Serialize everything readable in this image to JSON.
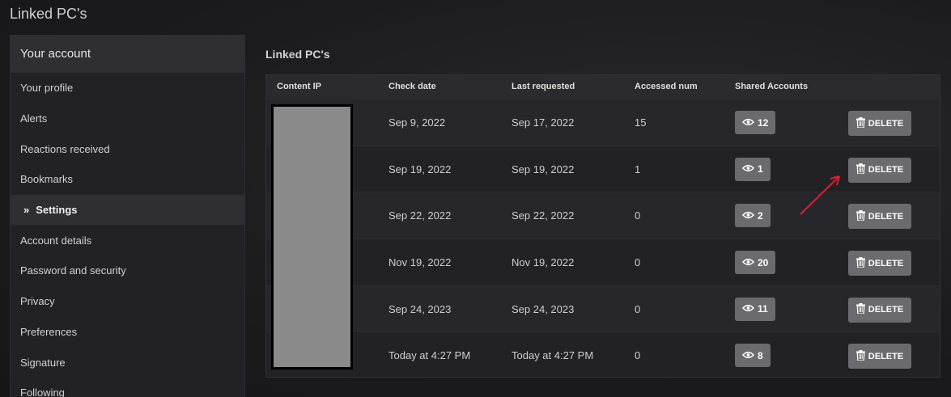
{
  "page": {
    "title": "Linked PC's"
  },
  "sidebar": {
    "header": "Your account",
    "items": [
      {
        "label": "Your profile",
        "active": false
      },
      {
        "label": "Alerts",
        "active": false
      },
      {
        "label": "Reactions received",
        "active": false
      },
      {
        "label": "Bookmarks",
        "active": false
      },
      {
        "label": "Settings",
        "active": true
      },
      {
        "label": "Account details",
        "active": false
      },
      {
        "label": "Password and security",
        "active": false
      },
      {
        "label": "Privacy",
        "active": false
      },
      {
        "label": "Preferences",
        "active": false
      },
      {
        "label": "Signature",
        "active": false
      },
      {
        "label": "Following",
        "active": false
      }
    ]
  },
  "main": {
    "title": "Linked PC's",
    "columns": {
      "content_ip": "Content IP",
      "check_date": "Check date",
      "last_requested": "Last requested",
      "accessed_num": "Accessed num",
      "shared_accounts": "Shared Accounts"
    },
    "delete_label": "DELETE",
    "rows": [
      {
        "check_date": "Sep 9, 2022",
        "last_requested": "Sep 17, 2022",
        "accessed_num": "15",
        "shared": "12"
      },
      {
        "check_date": "Sep 19, 2022",
        "last_requested": "Sep 19, 2022",
        "accessed_num": "1",
        "shared": "1"
      },
      {
        "check_date": "Sep 22, 2022",
        "last_requested": "Sep 22, 2022",
        "accessed_num": "0",
        "shared": "2"
      },
      {
        "check_date": "Nov 19, 2022",
        "last_requested": "Nov 19, 2022",
        "accessed_num": "0",
        "shared": "20"
      },
      {
        "check_date": "Sep 24, 2023",
        "last_requested": "Sep 24, 2023",
        "accessed_num": "0",
        "shared": "11"
      },
      {
        "check_date": "Today at 4:27 PM",
        "last_requested": "Today at 4:27 PM",
        "accessed_num": "0",
        "shared": "8"
      }
    ]
  },
  "colors": {
    "annotation_arrow": "#e01e2a",
    "button_bg": "#6b6b6f",
    "redaction": "#8a8a8a"
  },
  "icons": {
    "shared": "eye-icon",
    "delete": "trash-icon",
    "active_item": "chevron-double-right-icon"
  }
}
